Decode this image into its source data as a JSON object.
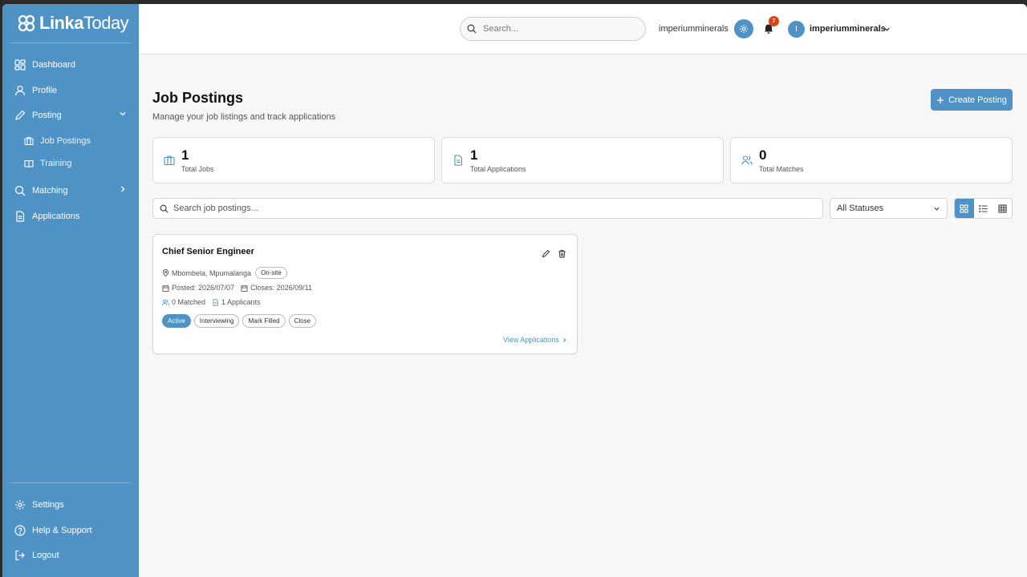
{
  "brand": {
    "name_bold": "Linka",
    "name_light": "Today"
  },
  "sidebar": {
    "items": [
      {
        "label": "Dashboard"
      },
      {
        "label": "Profile"
      },
      {
        "label": "Posting"
      },
      {
        "label": "Matching"
      },
      {
        "label": "Applications"
      }
    ],
    "sub_items": [
      {
        "label": "Job Postings"
      },
      {
        "label": "Training"
      }
    ],
    "bottom_items": [
      {
        "label": "Settings"
      },
      {
        "label": "Help & Support"
      },
      {
        "label": "Logout"
      }
    ]
  },
  "header": {
    "search_placeholder": "Search...",
    "org_name": "imperiumminerals",
    "notification_count": "7",
    "avatar_initial": "I",
    "user_name": "imperiumminerals"
  },
  "page": {
    "title": "Job Postings",
    "subtitle": "Manage your job listings and track applications",
    "create_label": "Create Posting"
  },
  "stats": [
    {
      "value": "1",
      "label": "Total Jobs"
    },
    {
      "value": "1",
      "label": "Total Applications"
    },
    {
      "value": "0",
      "label": "Total Matches"
    }
  ],
  "filters": {
    "search_placeholder": "Search job postings...",
    "status_selected": "All Statuses"
  },
  "job": {
    "title": "Chief Senior Engineer",
    "location": "Mbombela, Mpumalanga",
    "work_type": "On-site",
    "posted": "Posted: 2026/07/07",
    "closes": "Closes: 2026/09/11",
    "matched": "0 Matched",
    "applicants": "1 Applicants",
    "statuses": [
      "Active",
      "Interviewing",
      "Mark Filled",
      "Close"
    ],
    "view_label": "View Applications"
  },
  "colors": {
    "accent": "#4f93c6",
    "badge": "#d9431e"
  }
}
